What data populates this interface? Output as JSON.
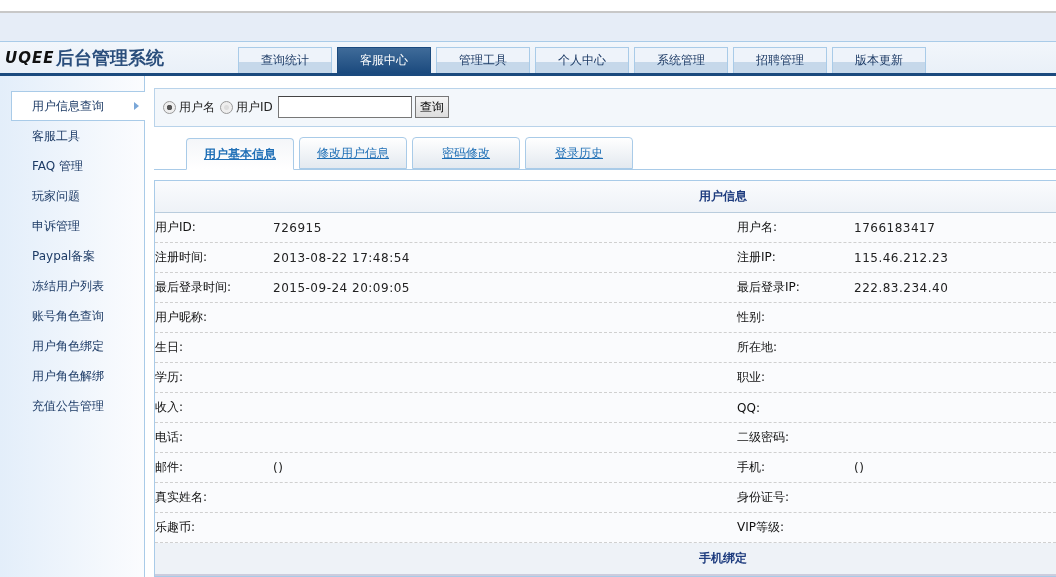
{
  "logo": {
    "brand": "UQEE",
    "title": "后台管理系统"
  },
  "nav": [
    {
      "label": "查询统计",
      "selected": false
    },
    {
      "label": "客服中心",
      "selected": true
    },
    {
      "label": "管理工具",
      "selected": false
    },
    {
      "label": "个人中心",
      "selected": false
    },
    {
      "label": "系统管理",
      "selected": false
    },
    {
      "label": "招聘管理",
      "selected": false
    },
    {
      "label": "版本更新",
      "selected": false
    }
  ],
  "sidebar": {
    "items": [
      {
        "label": "用户信息查询",
        "selected": true
      },
      {
        "label": "客服工具",
        "selected": false
      },
      {
        "label": "FAQ 管理",
        "selected": false
      },
      {
        "label": "玩家问题",
        "selected": false
      },
      {
        "label": "申诉管理",
        "selected": false
      },
      {
        "label": "Paypal备案",
        "selected": false
      },
      {
        "label": "冻结用户列表",
        "selected": false
      },
      {
        "label": "账号角色查询",
        "selected": false
      },
      {
        "label": "用户角色绑定",
        "selected": false
      },
      {
        "label": "用户角色解绑",
        "selected": false
      },
      {
        "label": "充值公告管理",
        "selected": false
      }
    ]
  },
  "search": {
    "options": [
      {
        "label": "用户名",
        "selected": true
      },
      {
        "label": "用户ID",
        "selected": false
      }
    ],
    "button": "查询"
  },
  "tabs": [
    {
      "label": "用户基本信息",
      "selected": true
    },
    {
      "label": "修改用户信息",
      "selected": false
    },
    {
      "label": "密码修改",
      "selected": false
    },
    {
      "label": "登录历史",
      "selected": false
    }
  ],
  "table": {
    "title": "用户信息",
    "rows": [
      {
        "label1": "用户ID:",
        "value1": "726915",
        "label2": "用户名:",
        "value2": "1766183417"
      },
      {
        "label1": "注册时间:",
        "value1": "2013-08-22 17:48:54",
        "label2": "注册IP:",
        "value2": "115.46.212.23"
      },
      {
        "label1": "最后登录时间:",
        "value1": "2015-09-24 20:09:05",
        "label2": "最后登录IP:",
        "value2": "222.83.234.40"
      },
      {
        "label1": "用户昵称:",
        "label2": "性别:"
      },
      {
        "label1": "生日:",
        "label2": "所在地:"
      },
      {
        "label1": "学历:",
        "label2": "职业:"
      },
      {
        "label1": "收入:",
        "label2": "QQ:"
      },
      {
        "label1": "电话:",
        "label2": "二级密码:"
      },
      {
        "label1": "邮件:",
        "value1": "()",
        "label2": "手机:",
        "value2": "()"
      },
      {
        "label1": "真实姓名:",
        "label2": "身份证号:"
      },
      {
        "label1": "乐趣币:",
        "label2": "VIP等级:"
      }
    ],
    "section": "手机绑定"
  }
}
